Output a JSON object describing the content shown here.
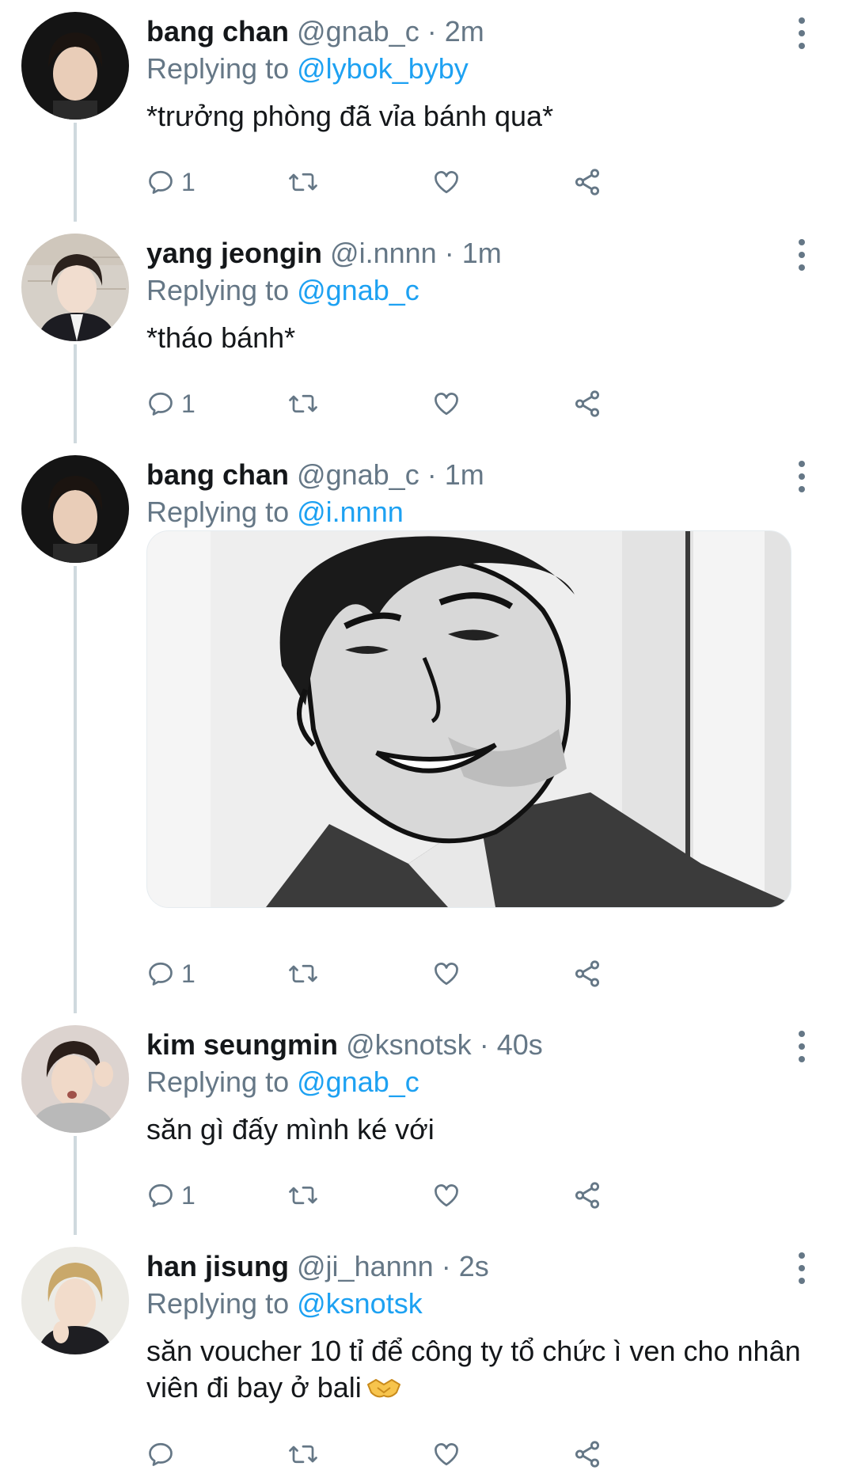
{
  "tweets": [
    {
      "name": "bang chan",
      "handle": "@gnab_c",
      "dot": "·",
      "time": "2m",
      "replying_label": "Replying to ",
      "replying_to": "@lybok_byby",
      "text": "*trưởng phòng đã vỉa bánh qua*",
      "reply_count": "1"
    },
    {
      "name": "yang jeongin",
      "handle": "@i.nnnn",
      "dot": "·",
      "time": "1m",
      "replying_label": "Replying to ",
      "replying_to": "@gnab_c",
      "text": "*tháo bánh*",
      "reply_count": "1"
    },
    {
      "name": "bang chan",
      "handle": "@gnab_c",
      "dot": "·",
      "time": "1m",
      "replying_label": "Replying to ",
      "replying_to": "@i.nnnn",
      "text": "",
      "reply_count": "1"
    },
    {
      "name": "kim seungmin",
      "handle": "@ksnotsk",
      "dot": "·",
      "time": "40s",
      "replying_label": "Replying to ",
      "replying_to": "@gnab_c",
      "text": "săn gì đấy mình ké với",
      "reply_count": "1"
    },
    {
      "name": "han jisung",
      "handle": "@ji_hannn",
      "dot": "·",
      "time": "2s",
      "replying_label": "Replying to ",
      "replying_to": "@ksnotsk",
      "text": "săn voucher 10 tỉ để công ty tổ chức ì ven cho nhân viên đi bay ở bali",
      "reply_count": ""
    }
  ],
  "icons": {
    "reply": "reply-icon",
    "retweet": "retweet-icon",
    "like": "heart-icon",
    "share": "share-icon",
    "more": "more-vertical-icon",
    "emoji": "handshake-emoji"
  },
  "colors": {
    "link": "#1da1f2",
    "secondary": "#657786",
    "thread": "#cfd9de"
  }
}
